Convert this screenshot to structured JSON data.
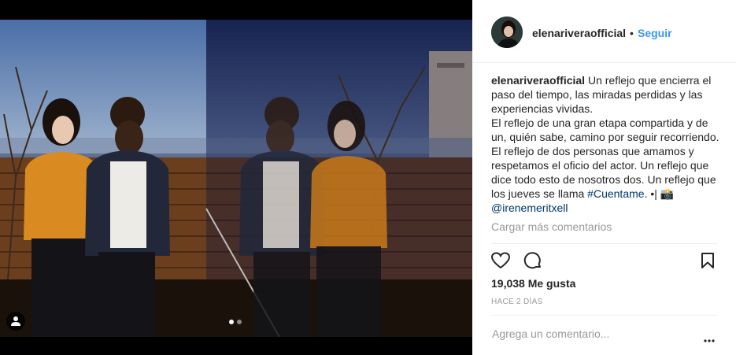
{
  "post": {
    "username": "elenariveraofficial",
    "separator": "•",
    "follow_label": "Seguir",
    "caption_username": "elenariveraofficial",
    "caption_line1": "Un reflejo que encierra el paso del tiempo, las miradas perdidas y las experiencias vividas.",
    "caption_line2": "El reflejo de una gran etapa compartida y de un, quién sabe, camino por seguir recorriendo. El reflejo de dos personas que amamos y respetamos el oficio del actor. Un reflejo que dice todo esto de nosotros dos. Un reflejo que los jueves se llama",
    "hashtag": "#Cuentame",
    "caption_tail": ". •| 📸",
    "mention": "@irenemeritxell",
    "load_more": "Cargar más comentarios",
    "likes": "19,038 Me gusta",
    "time_ago": "HACE 2 DÍAS",
    "comment_placeholder": "Agrega un comentario...",
    "more_label": "•••"
  },
  "carousel": {
    "current": 1,
    "total": 2
  },
  "icons": {
    "like": "heart-icon",
    "comment": "comment-icon",
    "save": "bookmark-icon",
    "tag": "user-tag-icon"
  },
  "colors": {
    "link": "#3897f0",
    "text": "#262626",
    "muted": "#999999"
  }
}
